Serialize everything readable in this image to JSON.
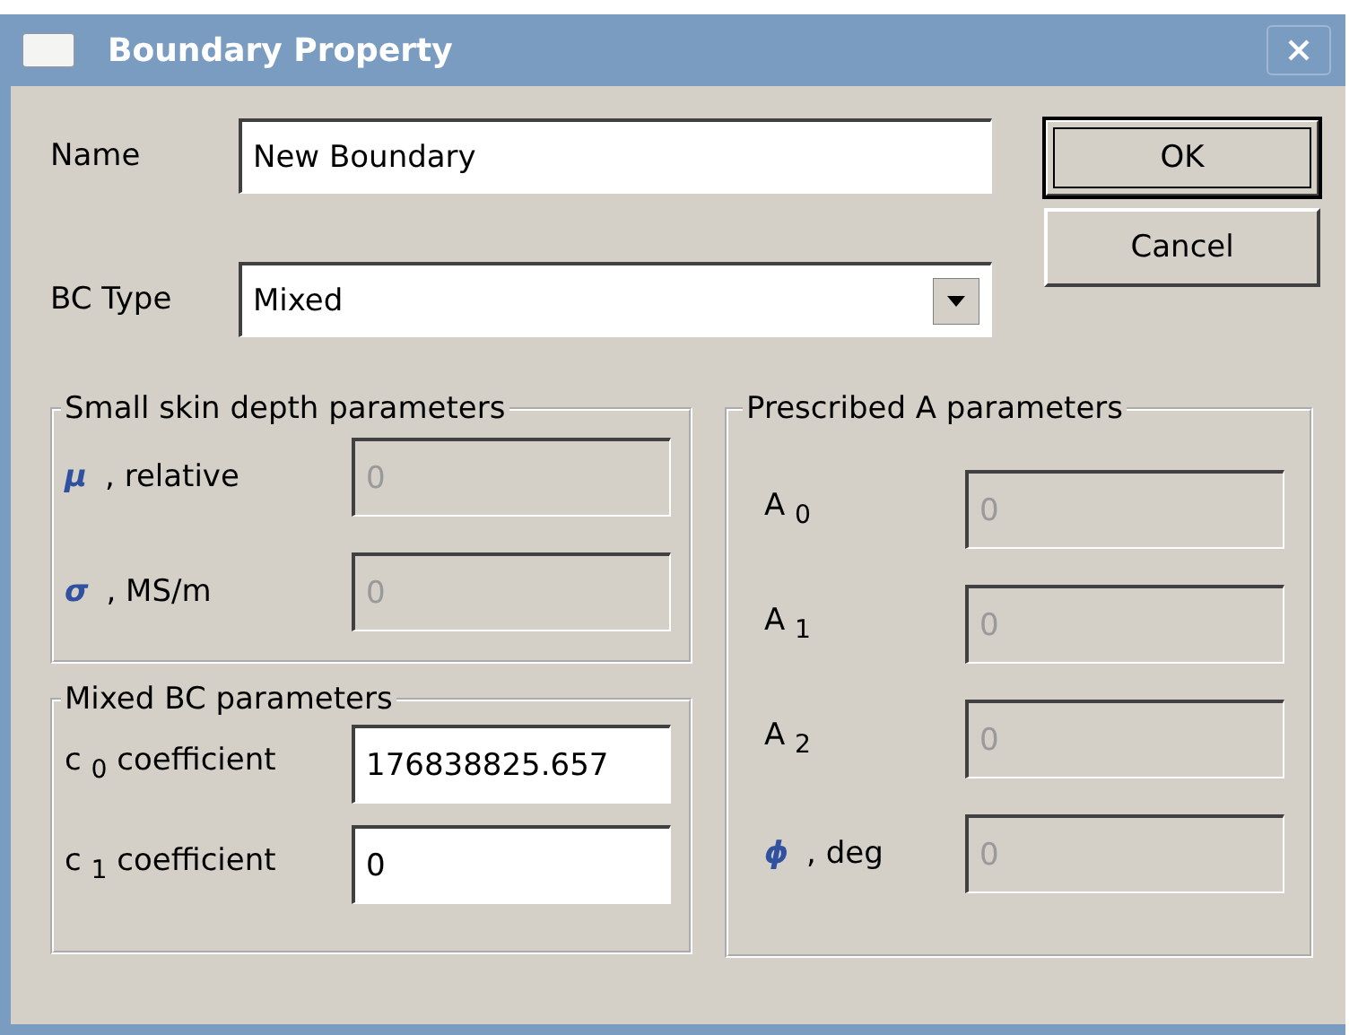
{
  "window": {
    "title": "Boundary Property"
  },
  "name": {
    "label": "Name",
    "value": "New Boundary"
  },
  "bc_type": {
    "label": "BC Type",
    "value": "Mixed"
  },
  "buttons": [
    {
      "label": "OK",
      "default": true
    },
    {
      "label": "Cancel",
      "default": false
    }
  ],
  "small_skin_depth": {
    "title": "Small skin depth parameters",
    "fields": [
      {
        "symbol": "μ",
        "label": ", relative",
        "value": "0",
        "disabled": true
      },
      {
        "symbol": "σ",
        "label": ", MS/m",
        "value": "0",
        "disabled": true
      }
    ]
  },
  "mixed_bc": {
    "title": "Mixed BC parameters",
    "fields": [
      {
        "label": "c $_{0}$ coefficient",
        "value": "176838825.657",
        "disabled": false
      },
      {
        "label": "c $_{1}$ coefficient",
        "value": "0",
        "disabled": false
      }
    ]
  },
  "prescribed_a": {
    "title": "Prescribed A parameters",
    "fields": [
      {
        "label": "A $_{0}$",
        "value": "0",
        "disabled": true
      },
      {
        "label": "A $_{1}$",
        "value": "0",
        "disabled": true
      },
      {
        "label": "A $_{2}$",
        "value": "0",
        "disabled": true
      },
      {
        "symbol": "ϕ",
        "label": ", deg",
        "value": "0",
        "disabled": true
      }
    ]
  }
}
